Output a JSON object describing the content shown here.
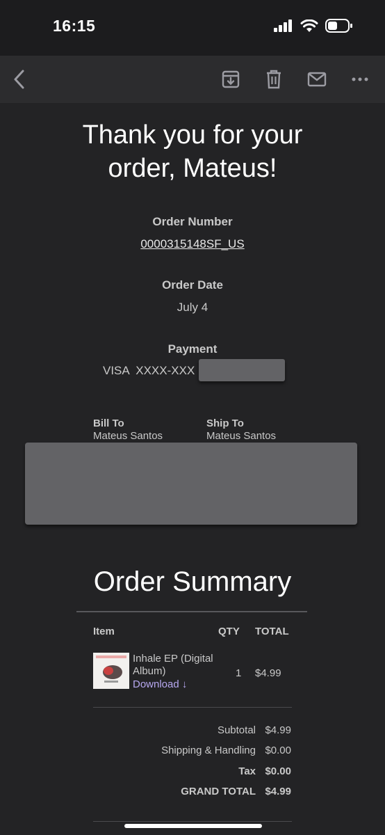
{
  "status_bar": {
    "time": "16:15"
  },
  "toolbar": {
    "back_icon": "chevron-left-icon",
    "archive_icon": "archive-icon",
    "trash_icon": "trash-icon",
    "mail_icon": "envelope-icon",
    "more_icon": "ellipsis-icon"
  },
  "email": {
    "headline_line1": "Thank you for your",
    "headline_line2": "order, Mateus!",
    "order_number_label": "Order Number",
    "order_number": "0000315148SF_US",
    "order_date_label": "Order Date",
    "order_date": "July 4",
    "payment_label": "Payment",
    "payment_value": "VISA  XXXX-XXX",
    "bill_to_label": "Bill To",
    "bill_to_name": "Mateus Santos",
    "ship_to_label": "Ship To",
    "ship_to_name": "Mateus Santos"
  },
  "summary": {
    "title": "Order Summary",
    "columns": {
      "item": "Item",
      "qty": "QTY",
      "total": "TOTAL"
    },
    "items": [
      {
        "name": "Inhale EP (Digital Album)",
        "download": "Download ↓",
        "qty": "1",
        "total": "$4.99"
      }
    ],
    "totals": [
      {
        "label": "Subtotal",
        "value": "$4.99",
        "bold": false
      },
      {
        "label": "Shipping & Handling",
        "value": "$0.00",
        "bold": false
      },
      {
        "label": "Tax",
        "value": "$0.00",
        "bold": true
      },
      {
        "label": "GRAND TOTAL",
        "value": "$4.99",
        "bold": true
      }
    ]
  },
  "colors": {
    "background": "#232325",
    "toolbar": "#2c2c2e",
    "link_purple": "#b7a8f0",
    "redaction": "#636366"
  }
}
